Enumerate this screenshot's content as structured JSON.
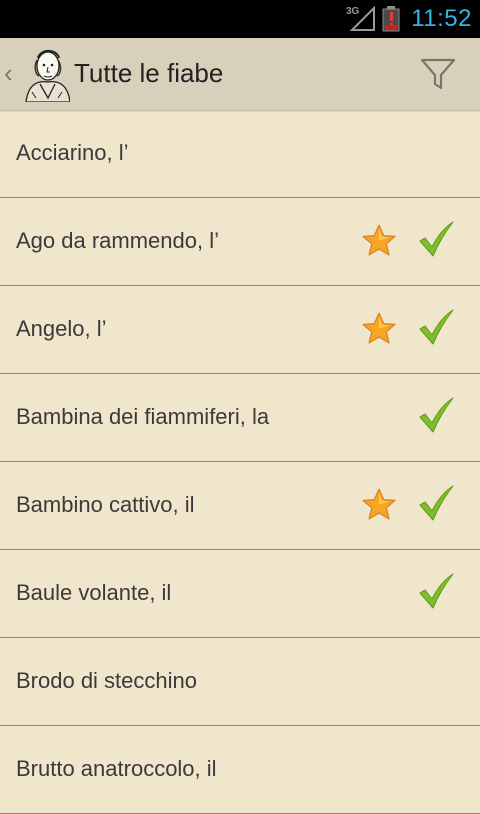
{
  "status": {
    "network": "3G",
    "time": "11:52"
  },
  "header": {
    "title": "Tutte le fiabe"
  },
  "list": {
    "items": [
      {
        "label": "Acciarino, l’",
        "favorite": false,
        "read": false
      },
      {
        "label": "Ago da rammendo, l’",
        "favorite": true,
        "read": true
      },
      {
        "label": "Angelo, l’",
        "favorite": true,
        "read": true
      },
      {
        "label": "Bambina dei fiammiferi, la",
        "favorite": false,
        "read": true
      },
      {
        "label": "Bambino cattivo, il",
        "favorite": true,
        "read": true
      },
      {
        "label": "Baule volante, il",
        "favorite": false,
        "read": true
      },
      {
        "label": "Brodo di stecchino",
        "favorite": false,
        "read": false
      },
      {
        "label": "Brutto anatroccolo, il",
        "favorite": false,
        "read": false
      }
    ]
  },
  "colors": {
    "background": "#f0e6cc",
    "action_bar": "#d8d0bb",
    "accent": "#33b5e5",
    "star": "#f5a623",
    "check": "#7cbf2a"
  },
  "icons": {
    "star": "star-icon",
    "check": "check-icon",
    "filter": "filter-icon",
    "up": "up-caret-icon",
    "app": "author-portrait-icon",
    "battery": "battery-low-icon",
    "signal": "signal-icon"
  }
}
